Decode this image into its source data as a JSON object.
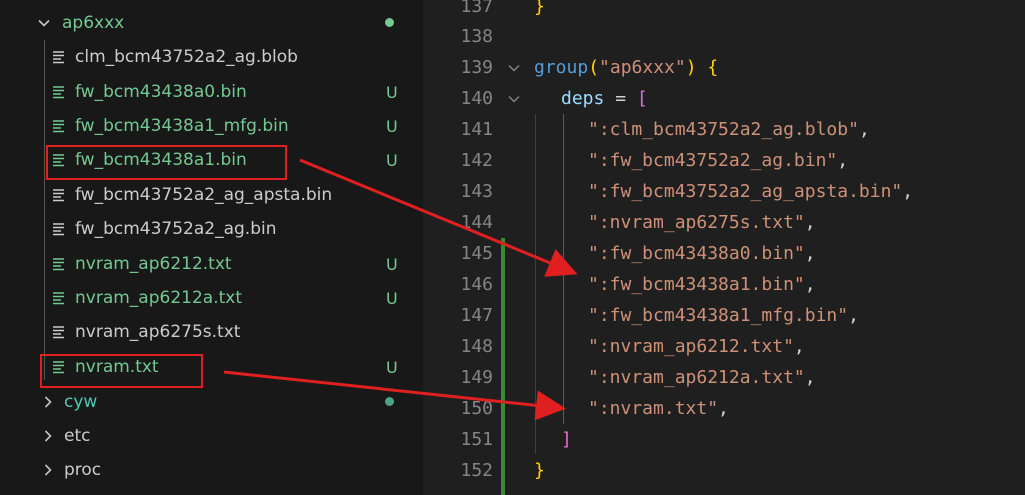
{
  "explorer": {
    "folder": {
      "name": "ap6xxx",
      "status": "dot"
    },
    "files": [
      {
        "name": "clm_bcm43752a2_ag.blob",
        "status": ""
      },
      {
        "name": "fw_bcm43438a0.bin",
        "status": "U"
      },
      {
        "name": "fw_bcm43438a1_mfg.bin",
        "status": "U"
      },
      {
        "name": "fw_bcm43438a1.bin",
        "status": "U"
      },
      {
        "name": "fw_bcm43752a2_ag_apsta.bin",
        "status": ""
      },
      {
        "name": "fw_bcm43752a2_ag.bin",
        "status": ""
      },
      {
        "name": "nvram_ap6212.txt",
        "status": "U"
      },
      {
        "name": "nvram_ap6212a.txt",
        "status": "U"
      },
      {
        "name": "nvram_ap6275s.txt",
        "status": ""
      },
      {
        "name": "nvram.txt",
        "status": "U"
      }
    ],
    "folders": [
      {
        "name": "cyw",
        "status": "dot"
      },
      {
        "name": "etc",
        "status": ""
      },
      {
        "name": "proc",
        "status": ""
      }
    ]
  },
  "editor": {
    "lines": [
      {
        "num": "137",
        "text": "}"
      },
      {
        "num": "138",
        "text": ""
      },
      {
        "num": "139",
        "fn": "group",
        "arg": "\"ap6xxx\"",
        "tail": " {"
      },
      {
        "num": "140",
        "var": "deps",
        "op": " = ",
        "brk": "["
      },
      {
        "num": "141",
        "str": "\":clm_bcm43752a2_ag.blob\"",
        "punc": ","
      },
      {
        "num": "142",
        "str": "\":fw_bcm43752a2_ag.bin\"",
        "punc": ","
      },
      {
        "num": "143",
        "str": "\":fw_bcm43752a2_ag_apsta.bin\"",
        "punc": ","
      },
      {
        "num": "144",
        "str": "\":nvram_ap6275s.txt\"",
        "punc": ","
      },
      {
        "num": "145",
        "str": "\":fw_bcm43438a0.bin\"",
        "punc": ","
      },
      {
        "num": "146",
        "str": "\":fw_bcm43438a1.bin\"",
        "punc": ","
      },
      {
        "num": "147",
        "str": "\":fw_bcm43438a1_mfg.bin\"",
        "punc": ","
      },
      {
        "num": "148",
        "str": "\":nvram_ap6212.txt\"",
        "punc": ","
      },
      {
        "num": "149",
        "str": "\":nvram_ap6212a.txt\"",
        "punc": ","
      },
      {
        "num": "150",
        "str": "\":nvram.txt\"",
        "punc": ","
      },
      {
        "num": "151",
        "text": "]"
      },
      {
        "num": "152",
        "text": "}"
      }
    ]
  },
  "colors": {
    "untracked": "#73c991",
    "highlight_box": "#e02020",
    "added_gutter": "#388a34"
  }
}
